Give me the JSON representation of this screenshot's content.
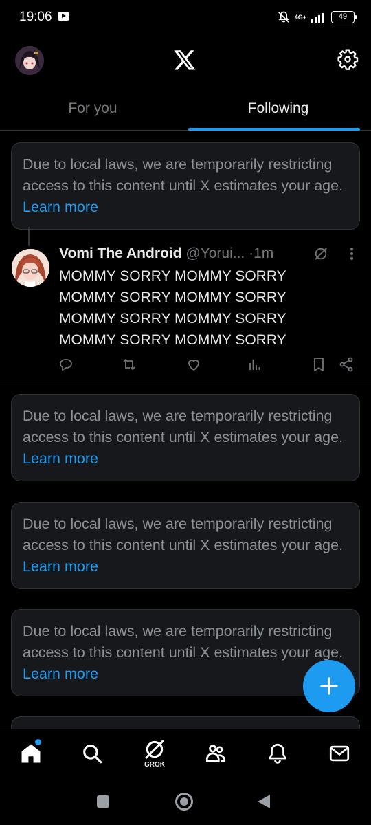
{
  "status_bar": {
    "time": "19:06",
    "network": "4G+",
    "battery": "49"
  },
  "header": {
    "avatar_icon": "user-avatar",
    "logo_icon": "x-logo",
    "settings_icon": "gear-icon"
  },
  "tabs": [
    {
      "label": "For you",
      "active": false
    },
    {
      "label": "Following",
      "active": true
    }
  ],
  "restricted_notice": {
    "text": "Due to local laws, we are temporarily restricting access to this content until X estimates your age.",
    "link": "Learn more"
  },
  "tweet": {
    "name": "Vomi The Android",
    "handle": "@Yorui...",
    "separator": "·",
    "time": "1m",
    "lines": [
      "MOMMY SORRY MOMMY SORRY",
      "MOMMY SORRY MOMMY SORRY",
      "MOMMY SORRY MOMMY SORRY",
      "MOMMY SORRY MOMMY SORRY"
    ]
  },
  "bottom_nav": {
    "grok_label": "GROK",
    "items": [
      "home-icon",
      "search-icon",
      "grok-icon",
      "communities-icon",
      "notifications-icon",
      "messages-icon"
    ]
  },
  "colors": {
    "accent": "#1d9bf0",
    "background": "#000000",
    "card": "#16181c",
    "muted": "#71767b"
  }
}
